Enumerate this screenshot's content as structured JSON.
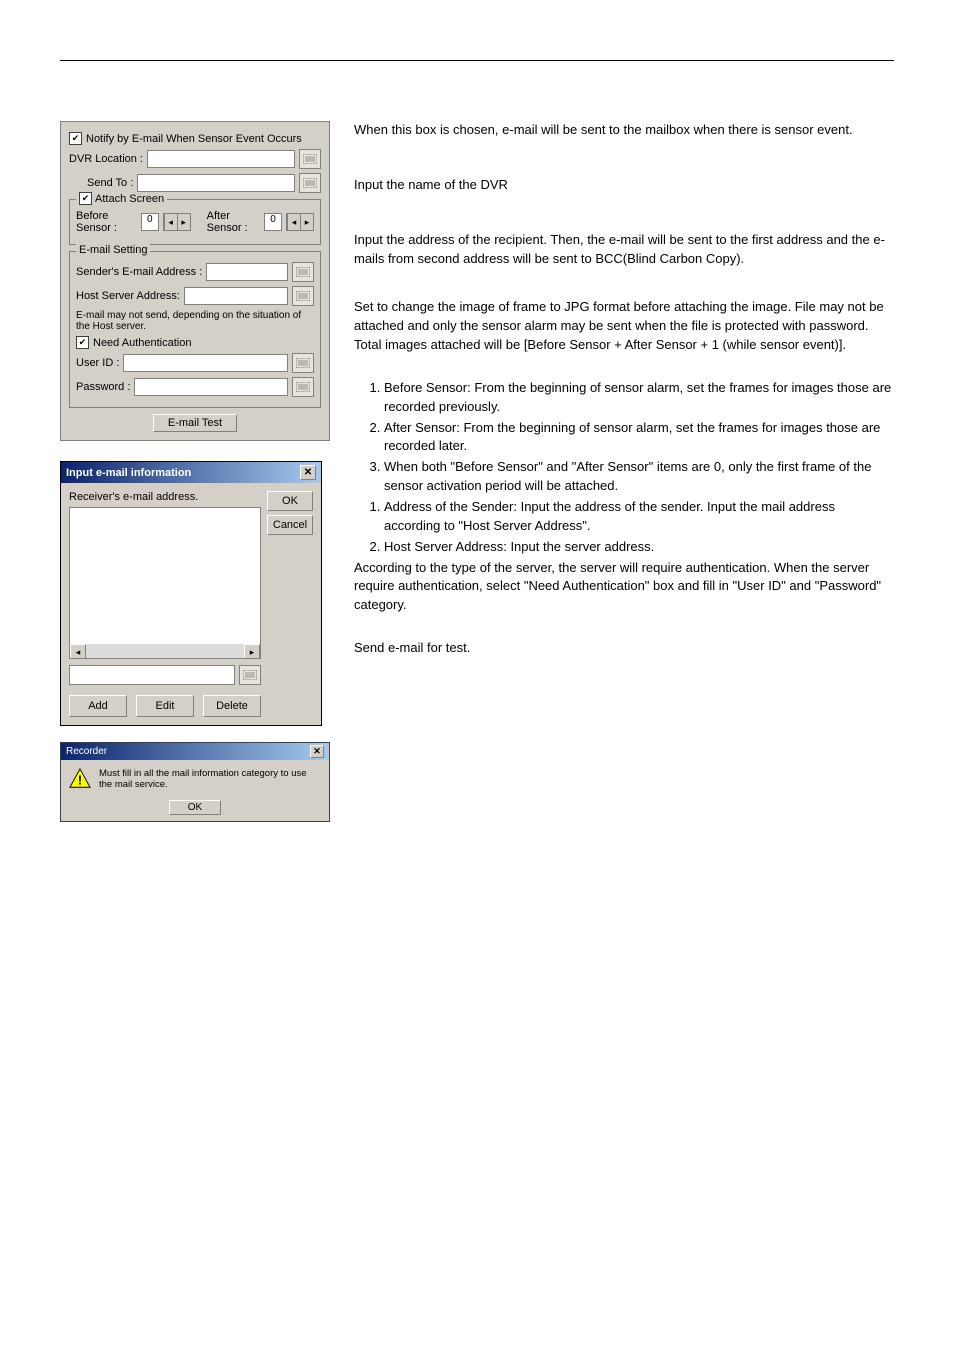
{
  "panel": {
    "notify_check_label": "Notify by E-mail When Sensor Event Occurs",
    "dvr_location_label": "DVR Location :",
    "send_to_label": "Send To :",
    "attach_group_label": "Attach Screen",
    "before_sensor_label": "Before Sensor :",
    "before_sensor_value": "0",
    "after_sensor_label": "After Sensor :",
    "after_sensor_value": "0",
    "email_setting_group_label": "E-mail Setting",
    "sender_addr_label": "Sender's E-mail Address :",
    "host_addr_label": "Host Server Address:",
    "note": "E-mail may not send, depending on the situation of the Host server.",
    "need_auth_label": "Need Authentication",
    "user_id_label": "User ID :",
    "password_label": "Password :",
    "email_test_btn": "E-mail Test"
  },
  "input_dialog": {
    "title": "Input e-mail information",
    "msg": "Receiver's e-mail address.",
    "ok": "OK",
    "cancel": "Cancel",
    "add": "Add",
    "edit": "Edit",
    "delete": "Delete"
  },
  "recorder_dialog": {
    "title": "Recorder",
    "msg": "Must fill in all the mail information category to use the mail service.",
    "ok": "OK"
  },
  "right": {
    "notify_desc": "When this box is chosen, e-mail will be sent to the mailbox when there is sensor event.",
    "dvr_desc": "Input the name of the DVR",
    "recipient_desc": "Input the address of the recipient. Then, the e-mail will be sent to the first address and the e-mails from second address will be sent to BCC(Blind Carbon Copy).",
    "attach_desc1": "Set to change the image of frame to JPG format before attaching the image. File may not be attached and only the sensor alarm may be sent when the file is protected with password.",
    "attach_desc2": "Total images attached will be [Before Sensor + After Sensor + 1 (while sensor event)].",
    "list1": {
      "i1": "Before Sensor: From the beginning of sensor alarm, set the frames for images those are recorded previously.",
      "i2": "After Sensor: From the beginning of sensor alarm, set the frames for images those are recorded later.",
      "i3": "When both \"Before Sensor\" and \"After Sensor\" items are 0, only the first frame of the sensor activation period will be attached."
    },
    "list2": {
      "i1": "Address of the Sender: Input the address of the sender. Input the mail address according to \"Host Server Address\".",
      "i2": "Host Server Address: Input the server address."
    },
    "auth_desc": "According to the type of the server, the server will require authentication. When the server require authentication, select \"Need Authentication\" box and fill in \"User ID\" and \"Password\" category.",
    "test_desc": "Send e-mail for test."
  }
}
